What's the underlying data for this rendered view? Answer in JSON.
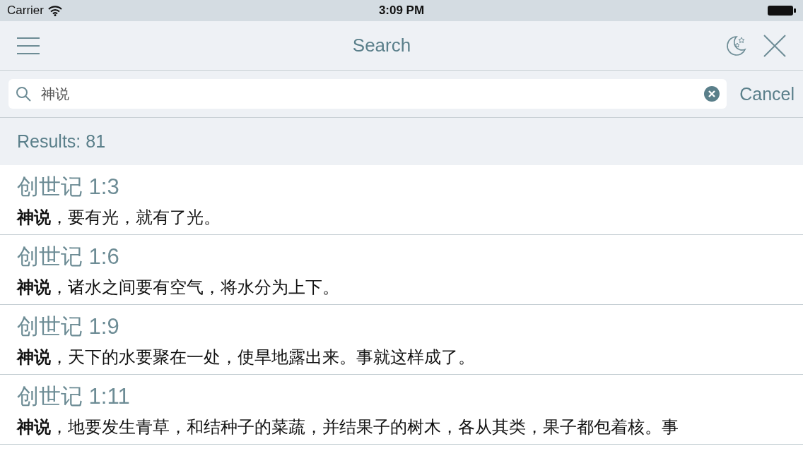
{
  "status_bar": {
    "carrier": "Carrier",
    "time": "3:09 PM"
  },
  "nav": {
    "title": "Search"
  },
  "search": {
    "value": "神说",
    "cancel": "Cancel"
  },
  "results": {
    "count": "Results: 81"
  },
  "rows": [
    {
      "reference": "创世记 1:3",
      "text": "**神说**，要有光，就有了光。"
    },
    {
      "reference": "创世记 1:6",
      "text": "**神说**，诸水之间要有空气，将水分为上下。"
    },
    {
      "reference": "创世记 1:9",
      "text": "**神说**，天下的水要聚在一处，使旱地露出来。事就这样成了。"
    },
    {
      "reference": "创世记 1:11",
      "text": "**神说**，地要发生青草，和结种子的菜蔬，并结果子的树木，各从其类，果子都包着核。事"
    }
  ]
}
